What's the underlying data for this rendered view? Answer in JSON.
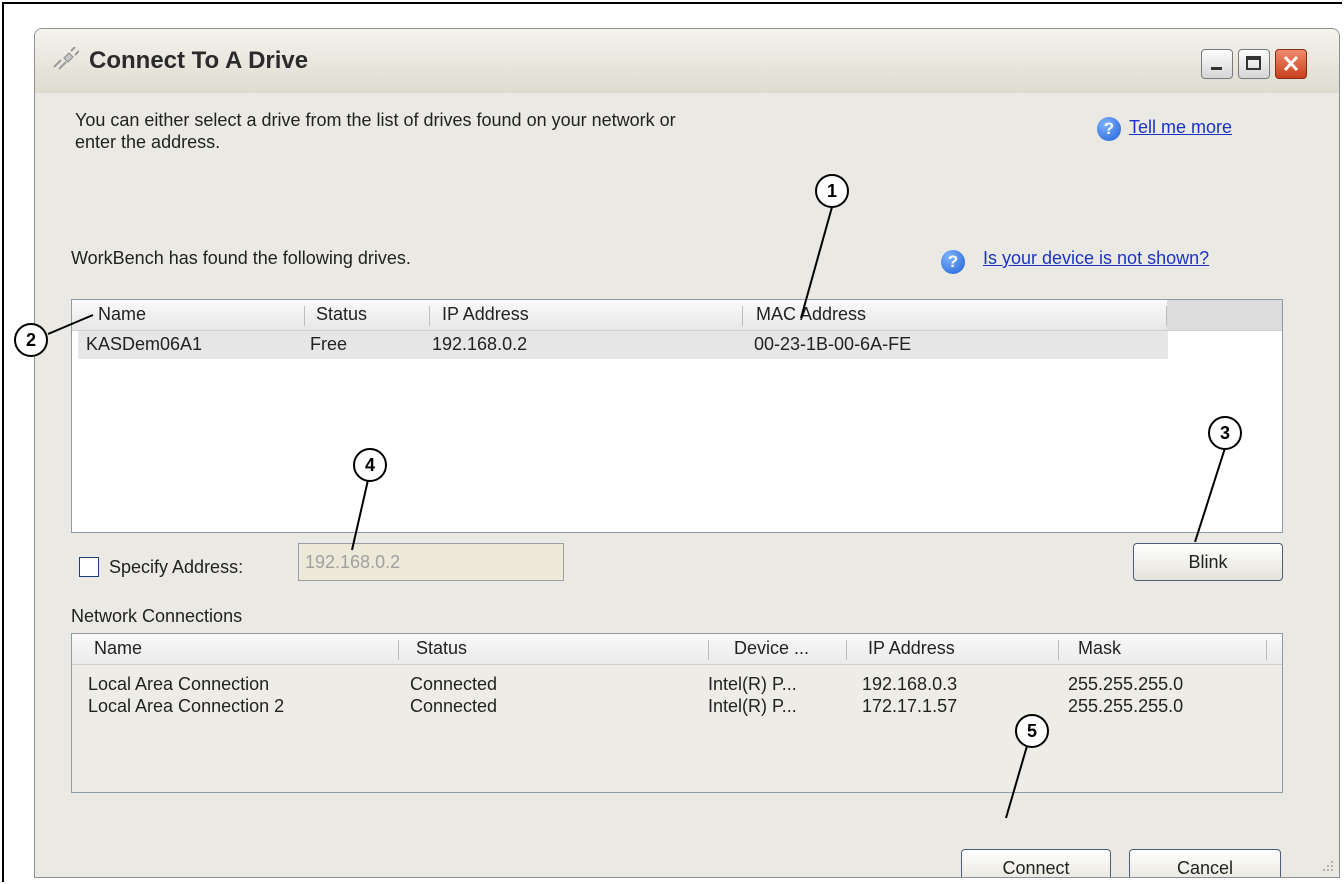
{
  "window": {
    "title": "Connect To A Drive",
    "controls": [
      "minimize",
      "maximize",
      "close"
    ]
  },
  "intro": {
    "line1": "You can either select a drive from the list of drives found on your network or",
    "line2": "enter the address.",
    "help_link": "Tell me more"
  },
  "drives": {
    "label": "WorkBench has found the following drives.",
    "help_link": "Is your device is not shown?",
    "columns": [
      "Name",
      "Status",
      "IP Address",
      "MAC Address"
    ],
    "rows": [
      {
        "name": "KASDem06A1",
        "status": "Free",
        "ip": "192.168.0.2",
        "mac": "00-23-1B-00-6A-FE"
      }
    ]
  },
  "specify": {
    "label": "Specify Address:",
    "value": "192.168.0.2",
    "checked": false
  },
  "blink_button": "Blink",
  "network": {
    "label": "Network Connections",
    "columns": [
      "Name",
      "Status",
      "Device ...",
      "IP Address",
      "Mask"
    ],
    "rows": [
      {
        "name": "Local Area Connection",
        "status": "Connected",
        "device": "Intel(R) P...",
        "ip": "192.168.0.3",
        "mask": "255.255.255.0"
      },
      {
        "name": "Local Area Connection 2",
        "status": "Connected",
        "device": "Intel(R) P...",
        "ip": "172.17.1.57",
        "mask": "255.255.255.0"
      }
    ]
  },
  "buttons": {
    "connect": "Connect",
    "cancel": "Cancel"
  },
  "callouts": [
    "1",
    "2",
    "3",
    "4",
    "5"
  ],
  "colors": {
    "link": "#1a34c6",
    "close_button": "#c9401e"
  }
}
